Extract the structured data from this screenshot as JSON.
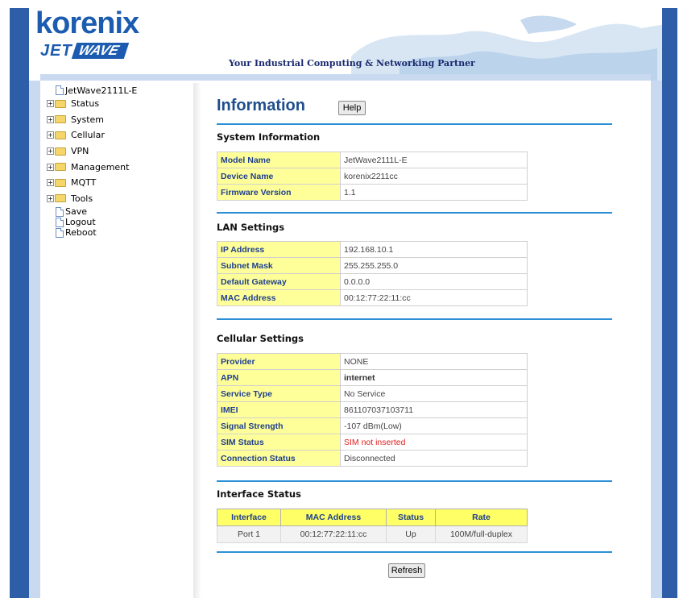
{
  "header": {
    "logo_korenix": "korenix",
    "logo_jet": "JET",
    "logo_wave": "WAVE",
    "tagline": "Your Industrial Computing & Networking Partner"
  },
  "nav": {
    "root": "JetWave2111L-E",
    "folders": [
      "Status",
      "System",
      "Cellular",
      "VPN",
      "Management",
      "MQTT",
      "Tools"
    ],
    "pages": [
      "Save",
      "Logout",
      "Reboot"
    ]
  },
  "main": {
    "title": "Information",
    "help_label": "Help",
    "refresh_label": "Refresh"
  },
  "system_info": {
    "title": "System Information",
    "rows": [
      {
        "key": "Model Name",
        "value": "JetWave2111L-E"
      },
      {
        "key": "Device Name",
        "value": "korenix2211cc"
      },
      {
        "key": "Firmware Version",
        "value": "1.1"
      }
    ]
  },
  "lan": {
    "title": "LAN Settings",
    "rows": [
      {
        "key": "IP Address",
        "value": "192.168.10.1"
      },
      {
        "key": "Subnet Mask",
        "value": "255.255.255.0"
      },
      {
        "key": "Default Gateway",
        "value": "0.0.0.0"
      },
      {
        "key": "MAC Address",
        "value": "00:12:77:22:11:cc"
      }
    ]
  },
  "cellular": {
    "title": "Cellular Settings",
    "rows": [
      {
        "key": "Provider",
        "value": "NONE"
      },
      {
        "key": "APN",
        "value": "internet"
      },
      {
        "key": "Service Type",
        "value": "No Service"
      },
      {
        "key": "IMEI",
        "value": "861107037103711"
      },
      {
        "key": "Signal Strength",
        "value": "-107 dBm(Low)"
      },
      {
        "key": "SIM Status",
        "value": "SIM not inserted"
      },
      {
        "key": "Connection Status",
        "value": "Disconnected"
      }
    ]
  },
  "interface": {
    "title": "Interface Status",
    "headers": [
      "Interface",
      "MAC Address",
      "Status",
      "Rate"
    ],
    "rows": [
      [
        "Port 1",
        "00:12:77:22:11:cc",
        "Up",
        "100M/full-duplex"
      ]
    ]
  },
  "colors": {
    "brand_blue": "#1c5cb0",
    "frame_blue": "#2f5ea8",
    "section_rule": "#2b8fd6",
    "key_cell": "#ffff99",
    "alert_red": "#e02020"
  }
}
